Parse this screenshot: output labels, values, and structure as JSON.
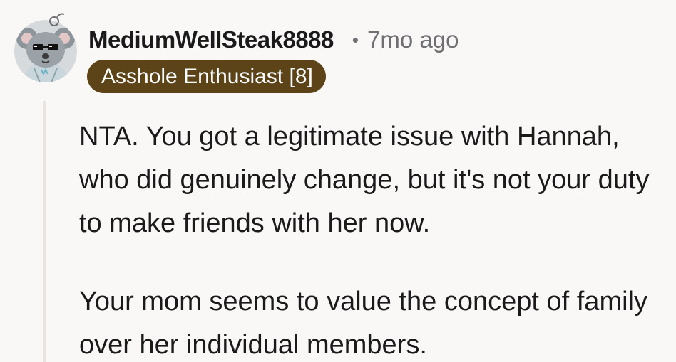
{
  "comment": {
    "author": "MediumWellSteak8888",
    "separator": "•",
    "timestamp": "7mo ago",
    "flair": "Asshole Enthusiast [8]",
    "avatar_icon": "koala-with-sunglasses-avatar",
    "paragraphs": [
      "NTA. You got a legitimate issue with Hannah, who did genuinely change, but it's not your duty to make friends with her now.",
      "Your mom seems to value the concept of family over her individual members."
    ]
  },
  "colors": {
    "background": "#faf8f7",
    "flair_background": "#5c4318",
    "meta_text": "#6f7073",
    "thread_line": "#e7e4e2"
  }
}
